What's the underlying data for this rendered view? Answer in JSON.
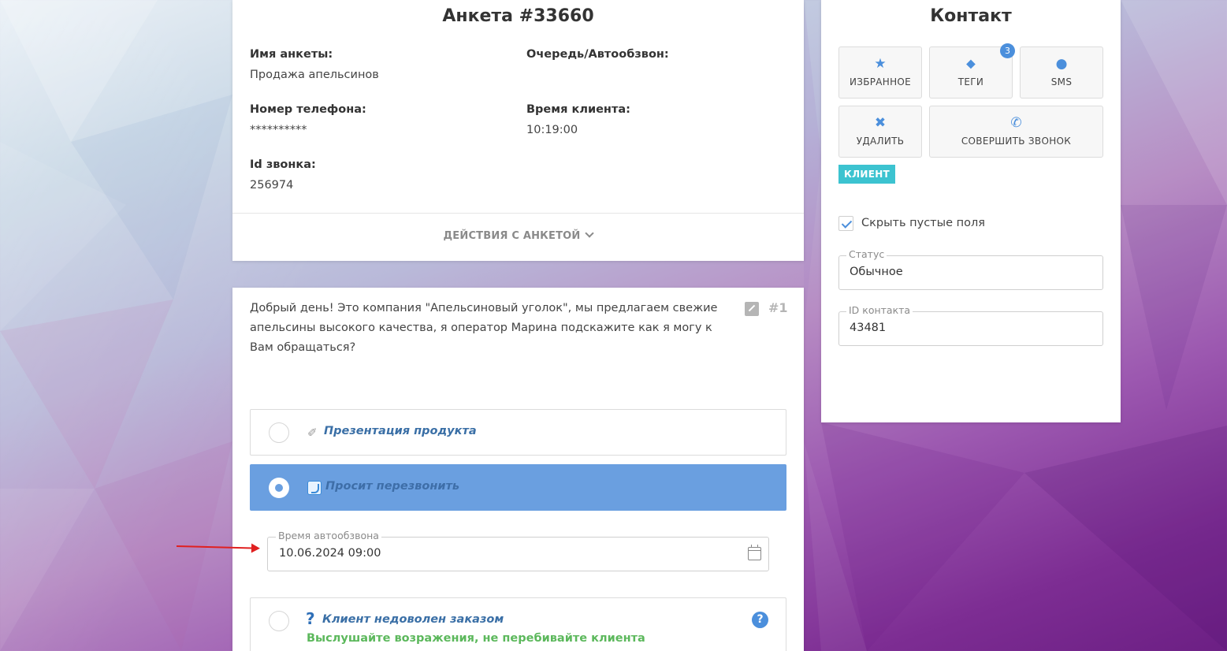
{
  "anketa": {
    "title": "Анкета #33660",
    "name_label": "Имя анкеты:",
    "name_value": "Продажа апельсинов",
    "queue_label": "Очередь/Автообзвон:",
    "phone_label": "Номер телефона:",
    "phone_value": "**********",
    "client_time_label": "Время клиента:",
    "client_time_value": "10:19:00",
    "call_id_label": "Id звонка:",
    "call_id_value": "256974",
    "actions_label": "ДЕЙСТВИЯ С АНКЕТОЙ"
  },
  "script": {
    "text": "Добрый день! Это компания \"Апельсиновый уголок\", мы предлагаем свежие апельсины высокого качества, я оператор Марина подскажите как я могу к Вам обращаться?",
    "step_number": "#1",
    "options": [
      {
        "label": "Презентация продукта",
        "icon": "pencil-check-icon",
        "selected": false
      },
      {
        "label": "Просит перезвонить",
        "icon": "phone-icon",
        "selected": true
      },
      {
        "label": "Клиент недоволен заказом",
        "icon": "question-mark-icon",
        "selected": false,
        "hint": "Выслушайте возражения, не перебивайте клиента"
      }
    ],
    "autodial_time_label": "Время автообзвона",
    "autodial_time_value": "10.06.2024 09:00"
  },
  "contact": {
    "title": "Контакт",
    "buttons": {
      "favorite": "ИЗБРАННОЕ",
      "tags": "ТЕГИ",
      "sms": "SMS",
      "delete": "УДАЛИТЬ",
      "call": "СОВЕРШИТЬ ЗВОНОК"
    },
    "tags_count": "3",
    "client_tag": "КЛИЕНТ",
    "hide_empty_label": "Скрыть пустые поля",
    "hide_empty_checked": true,
    "status_label": "Статус",
    "status_value": "Обычное",
    "contact_id_label": "ID контакта",
    "contact_id_value": "43481"
  },
  "colors": {
    "accent": "#4b8fdc",
    "selected_option": "#6a9fe0",
    "client_tag": "#3cc3d0",
    "hint": "#5cb85c",
    "annotation_arrow": "#e02020"
  }
}
